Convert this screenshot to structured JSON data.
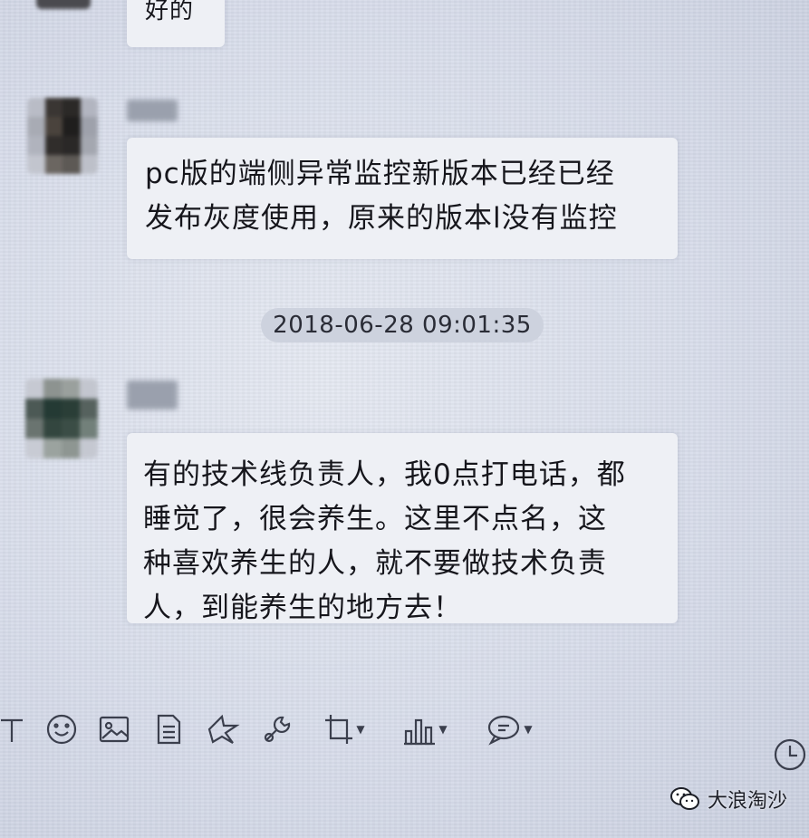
{
  "messages": [
    {
      "text_lines": [
        "好的"
      ]
    },
    {
      "text_lines": [
        "pc版的端侧异常监控新版本已经已经",
        "发布灰度使用，原来的版本l没有监控"
      ]
    },
    {
      "text_lines": [
        "有的技术线负责人，我0点打电话，都",
        "睡觉了，很会养生。这里不点名，这",
        "种喜欢养生的人，就不要做技术负责",
        "人，到能养生的地方去！"
      ]
    }
  ],
  "timestamp": "2018-06-28 09:01:35",
  "toolbar": {
    "tools": [
      "text-icon",
      "emoji-icon",
      "image-icon",
      "file-icon",
      "cut-icon",
      "wrench-icon",
      "crop-icon",
      "chart-icon",
      "chat-icon",
      "clock-icon"
    ]
  },
  "watermark": {
    "text": "大浪淘沙"
  },
  "colors": {
    "bubble": "#eef0f5",
    "background": "#d7dcea",
    "timestamp_bg": "#cdd2de"
  }
}
